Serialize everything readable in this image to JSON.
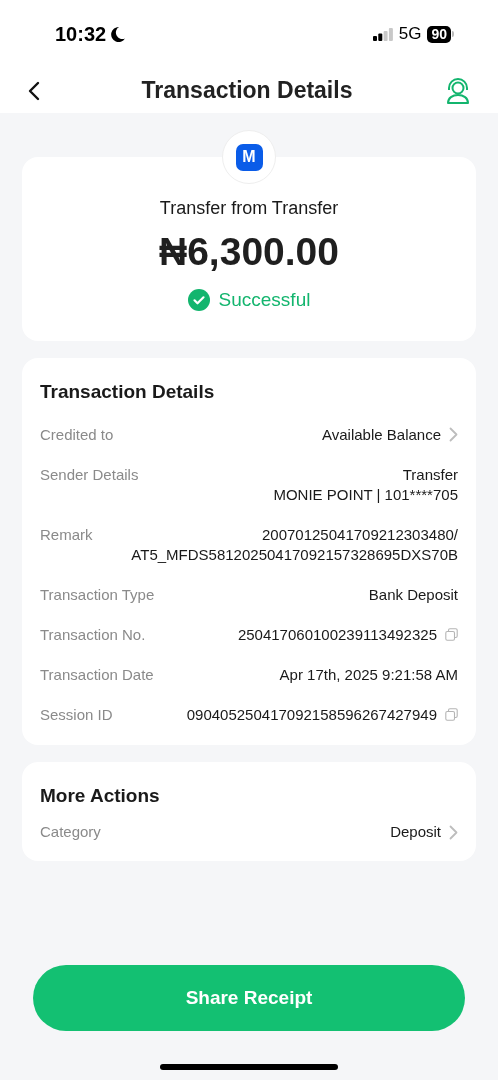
{
  "status_bar": {
    "time": "10:32",
    "network": "5G",
    "battery": "90"
  },
  "header": {
    "title": "Transaction Details"
  },
  "summary": {
    "logo": "M",
    "title": "Transfer from Transfer",
    "amount": "₦6,300.00",
    "status": "Successful"
  },
  "details": {
    "title": "Transaction Details",
    "rows": [
      {
        "label": "Credited to",
        "value": [
          "Available Balance"
        ],
        "kind": "chevron"
      },
      {
        "label": "Sender Details",
        "value": [
          "Transfer",
          "MONIE POINT | 101****705"
        ],
        "kind": "plain"
      },
      {
        "label": "Remark",
        "value": [
          "20070125041709212303480/",
          "AT5_MFDS58120250417092157328695DXS70B"
        ],
        "kind": "plain"
      },
      {
        "label": "Transaction Type",
        "value": [
          "Bank Deposit"
        ],
        "kind": "plain"
      },
      {
        "label": "Transaction No.",
        "value": [
          "250417060100239113492325"
        ],
        "kind": "copy"
      },
      {
        "label": "Transaction Date",
        "value": [
          "Apr 17th, 2025 9:21:58 AM"
        ],
        "kind": "plain"
      },
      {
        "label": "Session ID",
        "value": [
          "090405250417092158596267427949"
        ],
        "kind": "copy"
      }
    ]
  },
  "more_actions": {
    "title": "More Actions",
    "rows": [
      {
        "label": "Category",
        "value": [
          "Deposit"
        ],
        "kind": "chevron"
      }
    ]
  },
  "button": "Share Receipt"
}
